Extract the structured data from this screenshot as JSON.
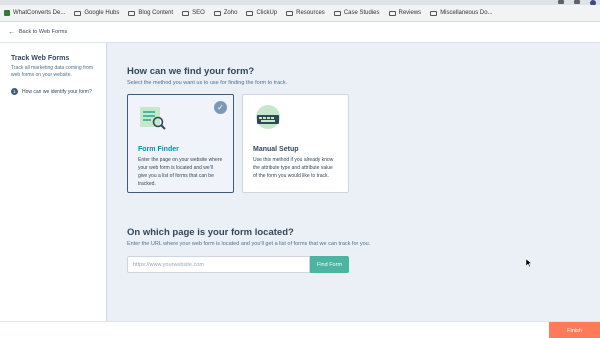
{
  "bookmarks": [
    {
      "label": "WhatConverts De...",
      "type": "site",
      "color": "#2e7d32"
    },
    {
      "label": "Google Hubs",
      "type": "folder"
    },
    {
      "label": "Blog Content",
      "type": "folder"
    },
    {
      "label": "SEO",
      "type": "folder"
    },
    {
      "label": "Zoho",
      "type": "folder"
    },
    {
      "label": "ClickUp",
      "type": "folder"
    },
    {
      "label": "Resources",
      "type": "folder"
    },
    {
      "label": "Case Studies",
      "type": "folder"
    },
    {
      "label": "Reviews",
      "type": "folder"
    },
    {
      "label": "Miscellaneous Do...",
      "type": "folder"
    }
  ],
  "header": {
    "back_label": "Back to Web Forms"
  },
  "sidebar": {
    "title": "Track Web Forms",
    "description": "Track all marketing data coming from web forms on your website.",
    "steps": [
      {
        "number": "1",
        "label": "How can we identify your form?"
      }
    ]
  },
  "main": {
    "find_heading": "How can we find your form?",
    "find_subheading": "Select the method you want us to use for finding the form to track.",
    "cards": [
      {
        "title": "Form Finder",
        "description": "Enter the page on your website where your web form is located and we'll give you a list of forms that can be tracked.",
        "selected": true,
        "icon": "form-search-icon"
      },
      {
        "title": "Manual Setup",
        "description": "Use this method if you already know the attribute type and attribute value of the form you would like to track.",
        "selected": false,
        "icon": "keyboard-icon"
      }
    ],
    "page_heading": "On which page is your form located?",
    "page_subheading": "Enter the URL where your web form is located and you'll get a list of forms that we can track for you.",
    "url_input": {
      "value": "",
      "placeholder": "https://www.yourwebsite.com"
    },
    "find_button_label": "Find Form"
  },
  "footer": {
    "finish_label": "Finish"
  },
  "colors": {
    "accent": "#0091ae",
    "find_button": "#4cb5a2",
    "finish_button": "#ff7a59"
  }
}
